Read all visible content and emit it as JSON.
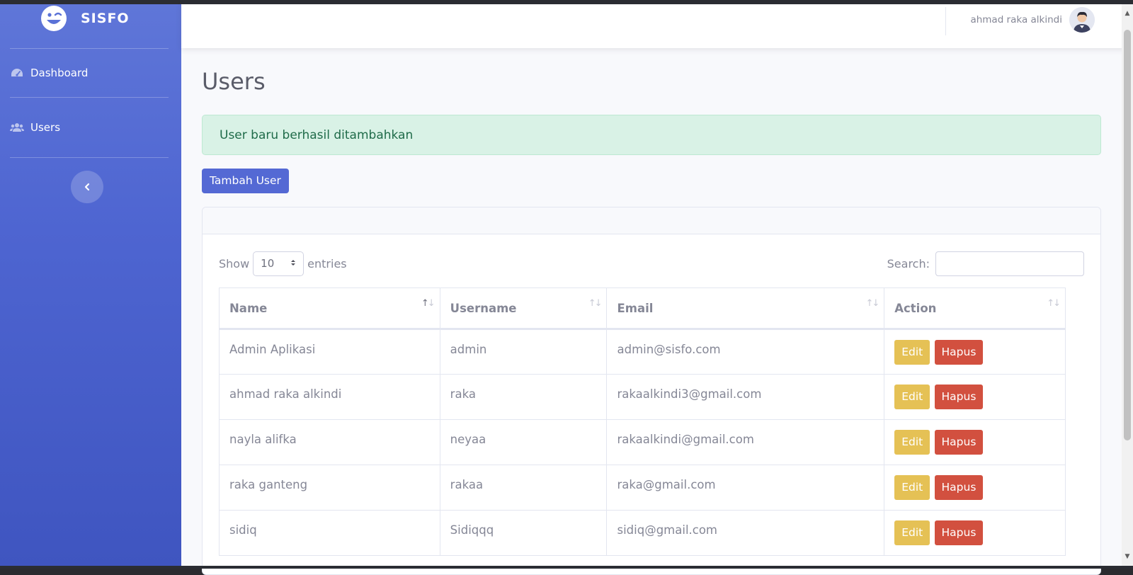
{
  "brand": {
    "name": "SISFO",
    "icon": "smiley-wink-icon"
  },
  "sidebar": {
    "items": [
      {
        "label": "Dashboard",
        "icon": "tachometer-icon"
      },
      {
        "label": "Users",
        "icon": "users-icon"
      }
    ],
    "toggle_icon": "chevron-left-icon"
  },
  "topnav": {
    "user_name": "ahmad raka alkindi",
    "avatar_icon": "user-avatar-icon"
  },
  "page": {
    "title": "Users",
    "alert": "User baru berhasil ditambahkan",
    "add_button": "Tambah User"
  },
  "datatable": {
    "show_label": "Show",
    "entries_value": "10",
    "entries_label": "entries",
    "search_label": "Search:",
    "search_value": "",
    "columns": [
      "Name",
      "Username",
      "Email",
      "Action"
    ],
    "rows": [
      {
        "name": "Admin Aplikasi",
        "username": "admin",
        "email": "admin@sisfo.com"
      },
      {
        "name": "ahmad raka alkindi",
        "username": "raka",
        "email": "rakaalkindi3@gmail.com"
      },
      {
        "name": "nayla alifka",
        "username": "neyaa",
        "email": "rakaalkindi@gmail.com"
      },
      {
        "name": "raka ganteng",
        "username": "rakaa",
        "email": "raka@gmail.com"
      },
      {
        "name": "sidiq",
        "username": "Sidiqqq",
        "email": "sidiq@gmail.com"
      }
    ],
    "edit_label": "Edit",
    "delete_label": "Hapus"
  },
  "colors": {
    "sidebar_top": "#5f76d8",
    "sidebar_bottom": "#3f55c0",
    "primary": "#5469d4",
    "success_bg": "#d9f2e6",
    "warning": "#e5c155",
    "danger": "#d2503f"
  }
}
